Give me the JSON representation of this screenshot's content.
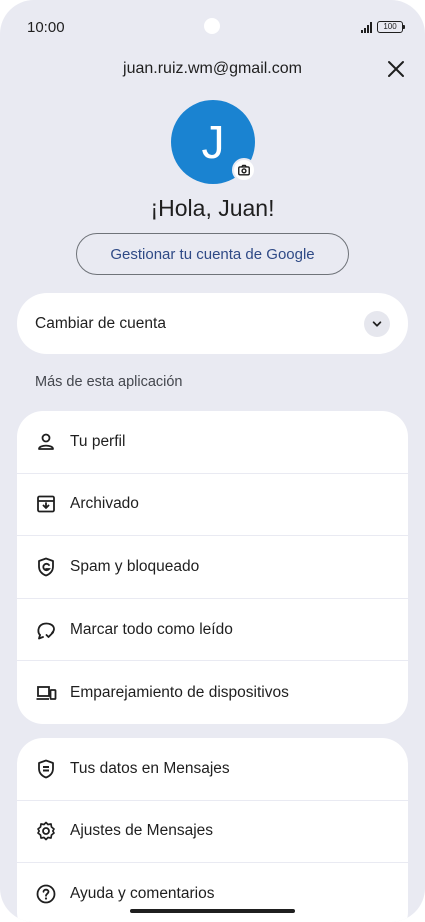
{
  "status_bar": {
    "time": "10:00",
    "battery": "100"
  },
  "header": {
    "email": "juan.ruiz.wm@gmail.com",
    "avatar_initial": "J",
    "greeting": "¡Hola, Juan!",
    "manage_button": "Gestionar tu cuenta de Google"
  },
  "switch_account": {
    "label": "Cambiar de cuenta"
  },
  "section_label": "Más de esta aplicación",
  "menu_group_1": [
    {
      "label": "Tu perfil",
      "icon": "person-icon"
    },
    {
      "label": "Archivado",
      "icon": "archive-icon"
    },
    {
      "label": "Spam y bloqueado",
      "icon": "spam-shield-icon"
    },
    {
      "label": "Marcar todo como leído",
      "icon": "mark-read-icon"
    },
    {
      "label": "Emparejamiento de dispositivos",
      "icon": "devices-icon"
    }
  ],
  "menu_group_2": [
    {
      "label": "Tus datos en Mensajes",
      "icon": "data-shield-icon"
    },
    {
      "label": "Ajustes de Mensajes",
      "icon": "settings-gear-icon"
    },
    {
      "label": "Ayuda y comentarios",
      "icon": "help-icon"
    }
  ],
  "colors": {
    "background": "#e9eaf2",
    "avatar": "#1a83d1",
    "button_text": "#2f4a86"
  }
}
